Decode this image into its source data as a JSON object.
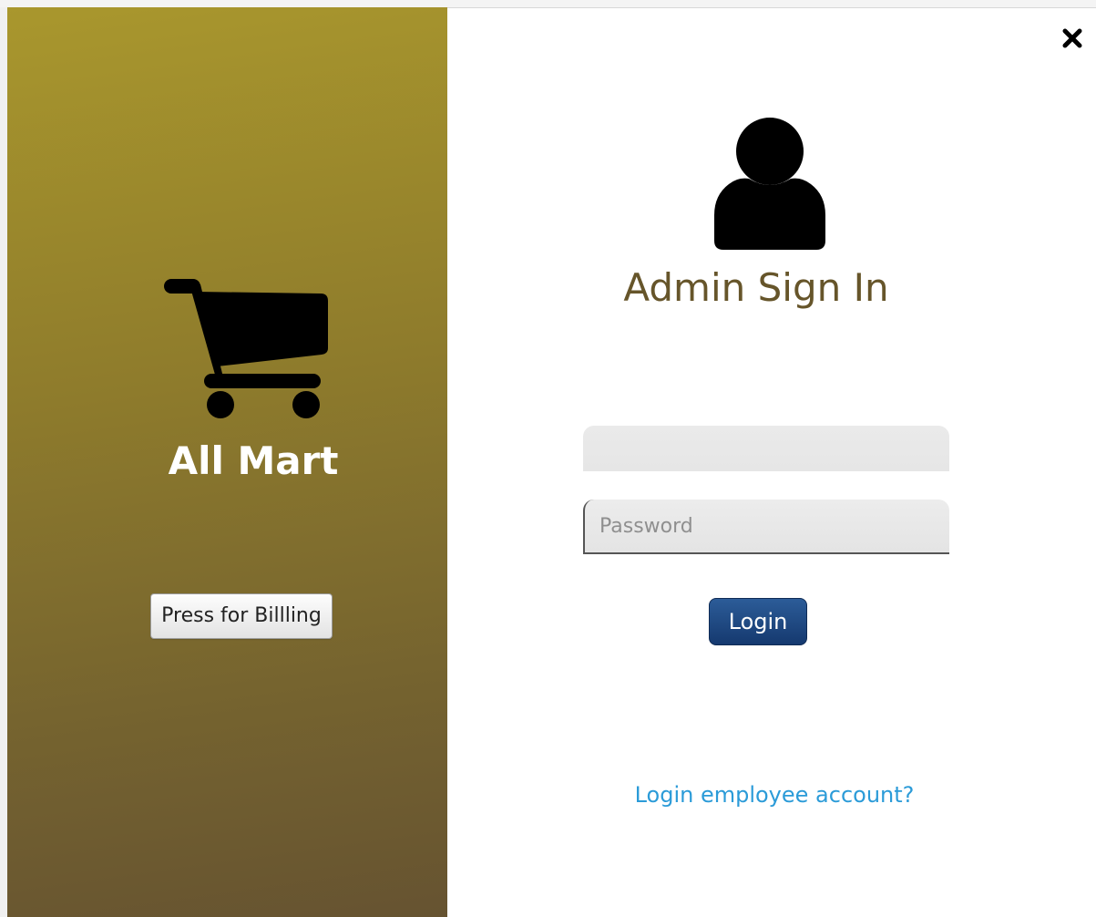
{
  "left_panel": {
    "brand_name": "All Mart",
    "cart_icon": "shopping-cart-icon",
    "billing_button_label": "Press for Billling",
    "gradient_colors": [
      "#a9972d",
      "#665331"
    ]
  },
  "header": {
    "close_icon": "close-icon"
  },
  "login_form": {
    "user_icon": "user-icon",
    "title": "Admin Sign In",
    "username_value": "",
    "password_placeholder": "Password",
    "login_label": "Login",
    "employee_link_label": "Login employee account?"
  },
  "colors": {
    "title": "#66552a",
    "login_button": "#1f4a82",
    "link": "#2b9bd8"
  }
}
